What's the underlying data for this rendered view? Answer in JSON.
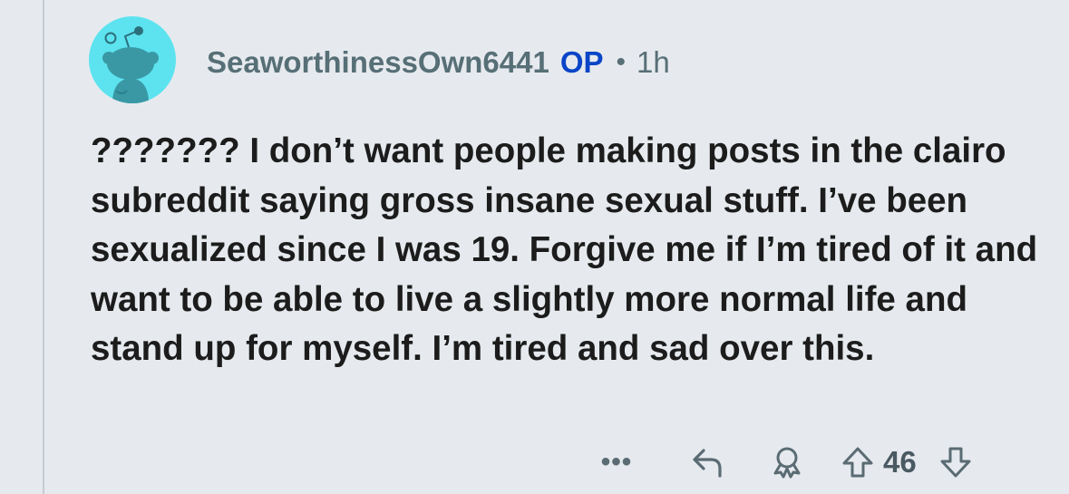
{
  "comment": {
    "username": "SeaworthinessOwn6441",
    "op_label": "OP",
    "separator": "•",
    "timestamp": "1h",
    "avatar_icon": "reddit-snoo-avatar-icon",
    "avatar_color": "#5ce3ef",
    "body": "??????? I don’t want people making posts in the clairo subreddit saying gross insane sexual stuff. I’ve been sexualized since I was 19. Forgive me if I’m tired of it and want to be able to live a slightly more normal life and stand up for myself. I’m tired and sad over this."
  },
  "actions": {
    "more_label": "•••",
    "reply_icon": "reply-arrow-icon",
    "award_icon": "award-icon",
    "upvote_icon": "upvote-arrow-icon",
    "score": "46",
    "downvote_icon": "downvote-arrow-icon"
  },
  "colors": {
    "background": "#e6eaee",
    "username": "#576f76",
    "op_badge": "#0a45c7",
    "body_text": "#1c1c1c",
    "icons": "#5a6b73"
  }
}
